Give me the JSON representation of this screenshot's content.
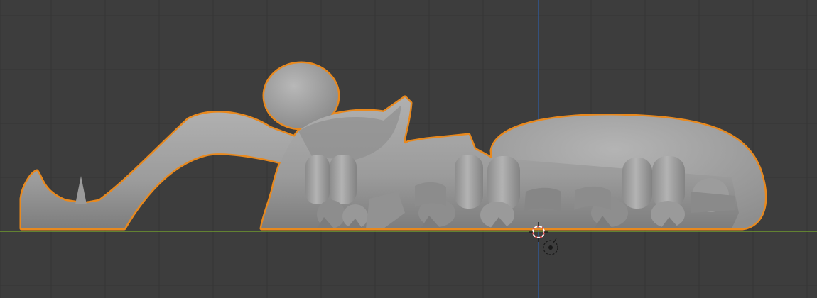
{
  "viewport": {
    "background_color": "#3d3d3d",
    "grid_color": "#353535",
    "x_axis_color": "#6e9a2e",
    "z_axis_color": "#2f5fa8",
    "selection_outline_color": "#e8891e",
    "mesh_color": "#a3a3a3"
  },
  "scene": {
    "object": {
      "icon": "spider-mesh",
      "selected": true
    },
    "cursor": {
      "icon": "3d-cursor-icon"
    },
    "light": {
      "icon": "light-icon"
    }
  }
}
